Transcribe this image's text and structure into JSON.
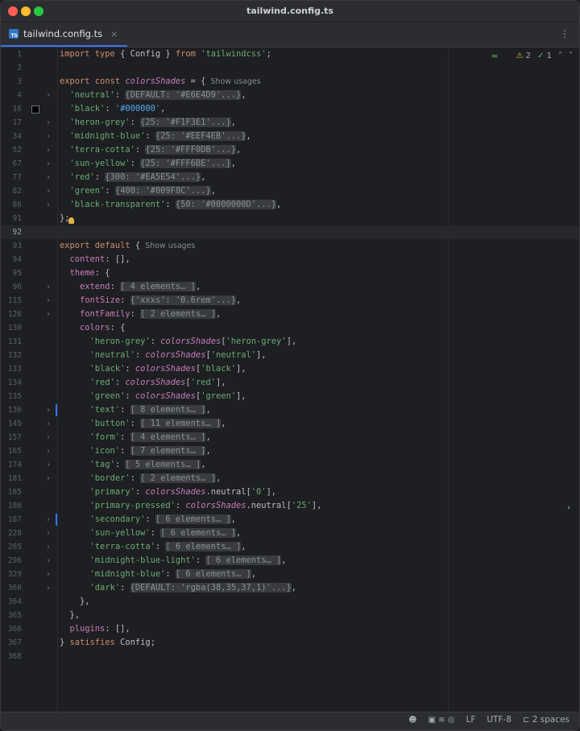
{
  "window": {
    "title": "tailwind.config.ts"
  },
  "tab": {
    "icon": "typescript-file-icon",
    "icon_text": "TS",
    "label": "tailwind.config.ts",
    "close": "×",
    "more": "⋮"
  },
  "inspections": {
    "ai_icon": "ai-assistant-icon",
    "warnings": "2",
    "ok_count": "1",
    "up": "˄",
    "down": "˅"
  },
  "status": {
    "line_separator": "LF",
    "encoding": "UTF-8",
    "indent": "2 spaces"
  },
  "lines": [
    {
      "n": "1",
      "t": [
        [
          "kw",
          "import type "
        ],
        [
          "",
          "{ Config } "
        ],
        [
          "kw",
          "from "
        ],
        [
          "str",
          "'tailwindcss'"
        ],
        [
          "",
          ";"
        ]
      ]
    },
    {
      "n": "2",
      "t": []
    },
    {
      "n": "3",
      "t": [
        [
          "kw",
          "export const "
        ],
        [
          "var",
          "colorsShades"
        ],
        [
          "",
          " = {"
        ]
      ],
      "hint": "Show usages"
    },
    {
      "n": "4",
      "fold": true,
      "t": [
        [
          "",
          "  "
        ],
        [
          "str",
          "'neutral'"
        ],
        [
          "",
          ": "
        ],
        [
          "box",
          "{DEFAULT: '#E6E4D9'...}"
        ],
        [
          "",
          ","
        ]
      ]
    },
    {
      "n": "16",
      "swatch": true,
      "t": [
        [
          "",
          "  "
        ],
        [
          "str",
          "'black'"
        ],
        [
          "",
          ": "
        ],
        [
          "str",
          "'"
        ],
        [
          "hex",
          "#000000"
        ],
        [
          "str",
          "'"
        ],
        [
          "",
          ","
        ]
      ]
    },
    {
      "n": "17",
      "fold": true,
      "t": [
        [
          "",
          "  "
        ],
        [
          "str",
          "'heron-grey'"
        ],
        [
          "",
          ": "
        ],
        [
          "box",
          "{25: '#F1F3E1'...}"
        ],
        [
          "",
          ","
        ]
      ]
    },
    {
      "n": "34",
      "fold": true,
      "t": [
        [
          "",
          "  "
        ],
        [
          "str",
          "'midnight-blue'"
        ],
        [
          "",
          ": "
        ],
        [
          "box",
          "{25: '#EEF4EB'...}"
        ],
        [
          "",
          ","
        ]
      ]
    },
    {
      "n": "52",
      "fold": true,
      "t": [
        [
          "",
          "  "
        ],
        [
          "str",
          "'terra-cotta'"
        ],
        [
          "",
          ": "
        ],
        [
          "box",
          "{25: '#FFF0DB'...}"
        ],
        [
          "",
          ","
        ]
      ]
    },
    {
      "n": "67",
      "fold": true,
      "t": [
        [
          "",
          "  "
        ],
        [
          "str",
          "'sun-yellow'"
        ],
        [
          "",
          ": "
        ],
        [
          "box",
          "{25: '#FFF6BE'...}"
        ],
        [
          "",
          ","
        ]
      ]
    },
    {
      "n": "77",
      "fold": true,
      "t": [
        [
          "",
          "  "
        ],
        [
          "str",
          "'red'"
        ],
        [
          "",
          ": "
        ],
        [
          "box",
          "{300: '#EA5E54'...}"
        ],
        [
          "",
          ","
        ]
      ]
    },
    {
      "n": "82",
      "fold": true,
      "t": [
        [
          "",
          "  "
        ],
        [
          "str",
          "'green'"
        ],
        [
          "",
          ": "
        ],
        [
          "box",
          "{400: '#009F8C'...}"
        ],
        [
          "",
          ","
        ]
      ]
    },
    {
      "n": "86",
      "fold": true,
      "t": [
        [
          "",
          "  "
        ],
        [
          "str",
          "'black-transparent'"
        ],
        [
          "",
          ": "
        ],
        [
          "box",
          "{50: '#0000000D'...}"
        ],
        [
          "",
          ","
        ]
      ]
    },
    {
      "n": "91",
      "bulb": true,
      "t": [
        [
          "",
          "};"
        ]
      ]
    },
    {
      "n": "92",
      "current": true,
      "t": []
    },
    {
      "n": "93",
      "t": [
        [
          "kw",
          "export default "
        ],
        [
          "",
          "{"
        ]
      ],
      "hint": "Show usages"
    },
    {
      "n": "94",
      "t": [
        [
          "",
          "  "
        ],
        [
          "prop",
          "content"
        ],
        [
          "",
          ": [],"
        ]
      ]
    },
    {
      "n": "95",
      "t": [
        [
          "",
          "  "
        ],
        [
          "prop",
          "theme"
        ],
        [
          "",
          ": {"
        ]
      ]
    },
    {
      "n": "96",
      "fold": true,
      "t": [
        [
          "",
          "    "
        ],
        [
          "prop",
          "extend"
        ],
        [
          "",
          ": "
        ],
        [
          "box",
          "[ 4 elements… ]"
        ],
        [
          "",
          ","
        ]
      ]
    },
    {
      "n": "115",
      "fold": true,
      "t": [
        [
          "",
          "    "
        ],
        [
          "prop",
          "fontSize"
        ],
        [
          "",
          ": "
        ],
        [
          "box",
          "{'xxxs': '0.6rem'...}"
        ],
        [
          "",
          ","
        ]
      ]
    },
    {
      "n": "126",
      "fold": true,
      "t": [
        [
          "",
          "    "
        ],
        [
          "prop",
          "fontFamily"
        ],
        [
          "",
          ": "
        ],
        [
          "box",
          "[ 2 elements… ]"
        ],
        [
          "",
          ","
        ]
      ]
    },
    {
      "n": "130",
      "t": [
        [
          "",
          "    "
        ],
        [
          "prop",
          "colors"
        ],
        [
          "",
          ": {"
        ]
      ]
    },
    {
      "n": "131",
      "t": [
        [
          "",
          "      "
        ],
        [
          "str",
          "'heron-grey'"
        ],
        [
          "",
          ": "
        ],
        [
          "var",
          "colorsShades"
        ],
        [
          "",
          "["
        ],
        [
          "str",
          "'heron-grey'"
        ],
        [
          "",
          "],"
        ]
      ]
    },
    {
      "n": "132",
      "t": [
        [
          "",
          "      "
        ],
        [
          "str",
          "'neutral'"
        ],
        [
          "",
          ": "
        ],
        [
          "var",
          "colorsShades"
        ],
        [
          "",
          "["
        ],
        [
          "str",
          "'neutral'"
        ],
        [
          "",
          "],"
        ]
      ]
    },
    {
      "n": "133",
      "t": [
        [
          "",
          "      "
        ],
        [
          "str",
          "'black'"
        ],
        [
          "",
          ": "
        ],
        [
          "var",
          "colorsShades"
        ],
        [
          "",
          "["
        ],
        [
          "str",
          "'black'"
        ],
        [
          "",
          "],"
        ]
      ]
    },
    {
      "n": "134",
      "t": [
        [
          "",
          "      "
        ],
        [
          "str",
          "'red'"
        ],
        [
          "",
          ": "
        ],
        [
          "var",
          "colorsShades"
        ],
        [
          "",
          "["
        ],
        [
          "str",
          "'red'"
        ],
        [
          "",
          "],"
        ]
      ]
    },
    {
      "n": "135",
      "t": [
        [
          "",
          "      "
        ],
        [
          "str",
          "'green'"
        ],
        [
          "",
          ": "
        ],
        [
          "var",
          "colorsShades"
        ],
        [
          "",
          "["
        ],
        [
          "str",
          "'green'"
        ],
        [
          "",
          "],"
        ]
      ]
    },
    {
      "n": "136",
      "fold": true,
      "vcs": true,
      "t": [
        [
          "",
          "      "
        ],
        [
          "str",
          "'text'"
        ],
        [
          "",
          ": "
        ],
        [
          "box",
          "[ 8 elements… ]"
        ],
        [
          "",
          ","
        ]
      ]
    },
    {
      "n": "145",
      "fold": true,
      "t": [
        [
          "",
          "      "
        ],
        [
          "str",
          "'button'"
        ],
        [
          "",
          ": "
        ],
        [
          "box",
          "[ 11 elements… ]"
        ],
        [
          "",
          ","
        ]
      ]
    },
    {
      "n": "157",
      "fold": true,
      "t": [
        [
          "",
          "      "
        ],
        [
          "str",
          "'form'"
        ],
        [
          "",
          ": "
        ],
        [
          "box",
          "[ 4 elements… ]"
        ],
        [
          "",
          ","
        ]
      ]
    },
    {
      "n": "165",
      "fold": true,
      "t": [
        [
          "",
          "      "
        ],
        [
          "str",
          "'icon'"
        ],
        [
          "",
          ": "
        ],
        [
          "box",
          "[ 7 elements… ]"
        ],
        [
          "",
          ","
        ]
      ]
    },
    {
      "n": "174",
      "fold": true,
      "t": [
        [
          "",
          "      "
        ],
        [
          "str",
          "'tag'"
        ],
        [
          "",
          ": "
        ],
        [
          "box",
          "[ 5 elements… ]"
        ],
        [
          "",
          ","
        ]
      ]
    },
    {
      "n": "181",
      "fold": true,
      "t": [
        [
          "",
          "      "
        ],
        [
          "str",
          "'border'"
        ],
        [
          "",
          ": "
        ],
        [
          "box",
          "[ 2 elements… ]"
        ],
        [
          "",
          ","
        ]
      ]
    },
    {
      "n": "185",
      "t": [
        [
          "",
          "      "
        ],
        [
          "str",
          "'primary'"
        ],
        [
          "",
          ": "
        ],
        [
          "var",
          "colorsShades"
        ],
        [
          "",
          ".neutral["
        ],
        [
          "str",
          "'0'"
        ],
        [
          "",
          "],"
        ]
      ]
    },
    {
      "n": "186",
      "t": [
        [
          "",
          "      "
        ],
        [
          "str",
          "'primary-pressed'"
        ],
        [
          "",
          ": "
        ],
        [
          "var",
          "colorsShades"
        ],
        [
          "",
          ".neutral["
        ],
        [
          "str",
          "'25'"
        ],
        [
          "",
          "],"
        ]
      ]
    },
    {
      "n": "187",
      "fold": true,
      "vcs": true,
      "t": [
        [
          "",
          "      "
        ],
        [
          "str",
          "'secondary'"
        ],
        [
          "",
          ": "
        ],
        [
          "box",
          "[ 6 elements… ]"
        ],
        [
          "",
          ","
        ]
      ]
    },
    {
      "n": "228",
      "fold": true,
      "t": [
        [
          "",
          "      "
        ],
        [
          "str",
          "'sun-yellow'"
        ],
        [
          "",
          ": "
        ],
        [
          "box",
          "[ 6 elements… ]"
        ],
        [
          "",
          ","
        ]
      ]
    },
    {
      "n": "265",
      "fold": true,
      "t": [
        [
          "",
          "      "
        ],
        [
          "str",
          "'terra-cotta'"
        ],
        [
          "",
          ": "
        ],
        [
          "box",
          "[ 6 elements… ]"
        ],
        [
          "",
          ","
        ]
      ]
    },
    {
      "n": "296",
      "fold": true,
      "t": [
        [
          "",
          "      "
        ],
        [
          "str",
          "'midnight-blue-light'"
        ],
        [
          "",
          ": "
        ],
        [
          "box",
          "[ 6 elements… ]"
        ],
        [
          "",
          ","
        ]
      ]
    },
    {
      "n": "329",
      "fold": true,
      "t": [
        [
          "",
          "      "
        ],
        [
          "str",
          "'midnight-blue'"
        ],
        [
          "",
          ": "
        ],
        [
          "box",
          "[ 6 elements… ]"
        ],
        [
          "",
          ","
        ]
      ]
    },
    {
      "n": "360",
      "fold": true,
      "t": [
        [
          "",
          "      "
        ],
        [
          "str",
          "'dark'"
        ],
        [
          "",
          ": "
        ],
        [
          "box",
          "{DEFAULT: 'rgba(38,35,37,1)'...}"
        ],
        [
          "",
          ","
        ]
      ]
    },
    {
      "n": "364",
      "t": [
        [
          "",
          "    },"
        ]
      ]
    },
    {
      "n": "365",
      "t": [
        [
          "",
          "  },"
        ]
      ]
    },
    {
      "n": "366",
      "t": [
        [
          "",
          "  "
        ],
        [
          "prop",
          "plugins"
        ],
        [
          "",
          ": [],"
        ]
      ]
    },
    {
      "n": "367",
      "t": [
        [
          "",
          "} "
        ],
        [
          "kw",
          "satisfies "
        ],
        [
          "",
          "Config;"
        ]
      ]
    },
    {
      "n": "368",
      "t": []
    }
  ]
}
